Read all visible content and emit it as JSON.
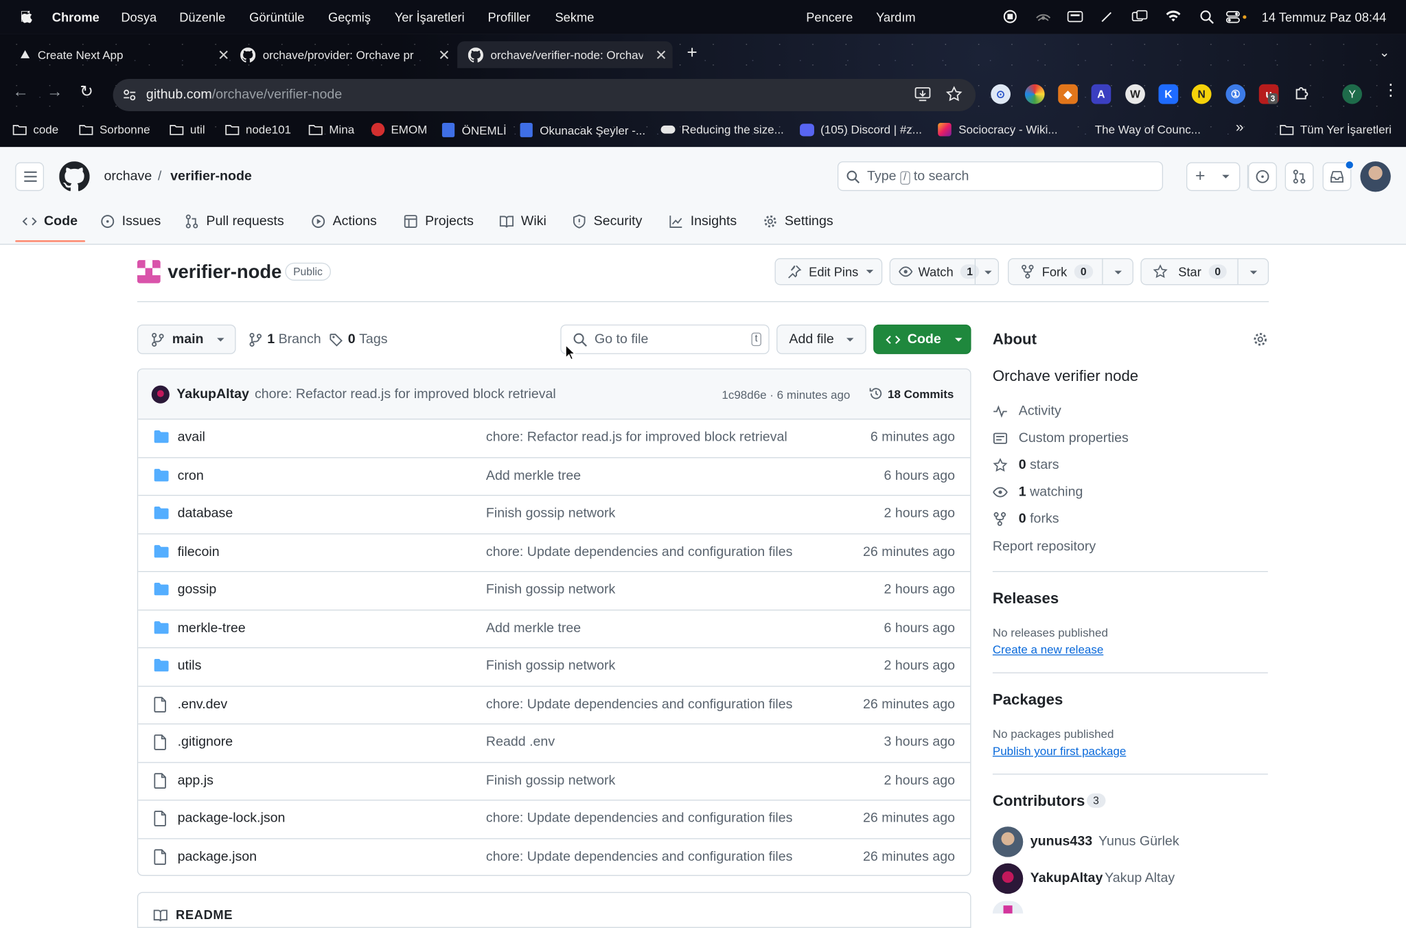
{
  "menubar": {
    "app": "Chrome",
    "items": [
      "Dosya",
      "Düzenle",
      "Görüntüle",
      "Geçmiş",
      "Yer İşaretleri",
      "Profiller",
      "Sekme"
    ],
    "right_items": [
      "Pencere",
      "Yardım"
    ],
    "clock": "14 Temmuz Paz  08:44"
  },
  "tabs": [
    {
      "title": "Create Next App"
    },
    {
      "title": "orchave/provider: Orchave pr"
    },
    {
      "title": "orchave/verifier-node: Orchav"
    }
  ],
  "address": {
    "host": "github.com",
    "path": "/orchave/verifier-node"
  },
  "profile_initial": "Y",
  "extensions": {
    "badge": "3"
  },
  "bookmarks": [
    "code",
    "Sorbonne",
    "util",
    "node101",
    "Mina",
    "EMOM",
    "ÖNEMLİ",
    "Okunacak Şeyler -...",
    "Reducing the size...",
    "(105) Discord | #z...",
    "Sociocracy - Wiki...",
    "The Way of Counc...",
    "Tüm Yer İşaretleri"
  ],
  "gh": {
    "owner": "orchave",
    "sep": "/",
    "repo": "verifier-node",
    "search_pre": "Type",
    "search_key": "/",
    "search_post": "to search",
    "nav": [
      "Code",
      "Issues",
      "Pull requests",
      "Actions",
      "Projects",
      "Wiki",
      "Security",
      "Insights",
      "Settings"
    ],
    "visibility": "Public",
    "edit_pins": "Edit Pins",
    "watch": "Watch",
    "watch_count": "1",
    "fork": "Fork",
    "fork_count": "0",
    "star": "Star",
    "star_count": "0",
    "branch": "main",
    "branch_count": "1",
    "branch_label": "Branch",
    "tag_count": "0",
    "tag_label": "Tags",
    "goto_placeholder": "Go to file",
    "goto_key": "t",
    "add_file": "Add file",
    "code_btn": "Code",
    "commit": {
      "author": "YakupAltay",
      "message": "chore: Refactor read.js for improved block retrieval",
      "hash_time": "1c98d6e · 6 minutes ago",
      "commits": "18 Commits"
    },
    "files": [
      {
        "name": "avail",
        "type": "dir",
        "msg": "chore: Refactor read.js for improved block retrieval",
        "age": "6 minutes ago"
      },
      {
        "name": "cron",
        "type": "dir",
        "msg": "Add merkle tree",
        "age": "6 hours ago"
      },
      {
        "name": "database",
        "type": "dir",
        "msg": "Finish gossip network",
        "age": "2 hours ago"
      },
      {
        "name": "filecoin",
        "type": "dir",
        "msg": "chore: Update dependencies and configuration files",
        "age": "26 minutes ago"
      },
      {
        "name": "gossip",
        "type": "dir",
        "msg": "Finish gossip network",
        "age": "2 hours ago"
      },
      {
        "name": "merkle-tree",
        "type": "dir",
        "msg": "Add merkle tree",
        "age": "6 hours ago"
      },
      {
        "name": "utils",
        "type": "dir",
        "msg": "Finish gossip network",
        "age": "2 hours ago"
      },
      {
        "name": ".env.dev",
        "type": "file",
        "msg": "chore: Update dependencies and configuration files",
        "age": "26 minutes ago"
      },
      {
        "name": ".gitignore",
        "type": "file",
        "msg": "Readd .env",
        "age": "3 hours ago"
      },
      {
        "name": "app.js",
        "type": "file",
        "msg": "Finish gossip network",
        "age": "2 hours ago"
      },
      {
        "name": "package-lock.json",
        "type": "file",
        "msg": "chore: Update dependencies and configuration files",
        "age": "26 minutes ago"
      },
      {
        "name": "package.json",
        "type": "file",
        "msg": "chore: Update dependencies and configuration files",
        "age": "26 minutes ago"
      }
    ],
    "readme_label": "README",
    "about": {
      "title": "About",
      "description": "Orchave verifier node",
      "activity": "Activity",
      "custom_props": "Custom properties",
      "stars": "0",
      "stars_label": "stars",
      "watching": "1",
      "watching_label": "watching",
      "forks": "0",
      "forks_label": "forks",
      "report": "Report repository"
    },
    "releases": {
      "title": "Releases",
      "none": "No releases published",
      "link": "Create a new release"
    },
    "packages": {
      "title": "Packages",
      "none": "No packages published",
      "link": "Publish your first package"
    },
    "contributors": {
      "title": "Contributors",
      "count": "3",
      "list": [
        {
          "login": "yunus433",
          "name": "Yunus Gürlek"
        },
        {
          "login": "YakupAltay",
          "name": "Yakup Altay"
        }
      ]
    }
  }
}
